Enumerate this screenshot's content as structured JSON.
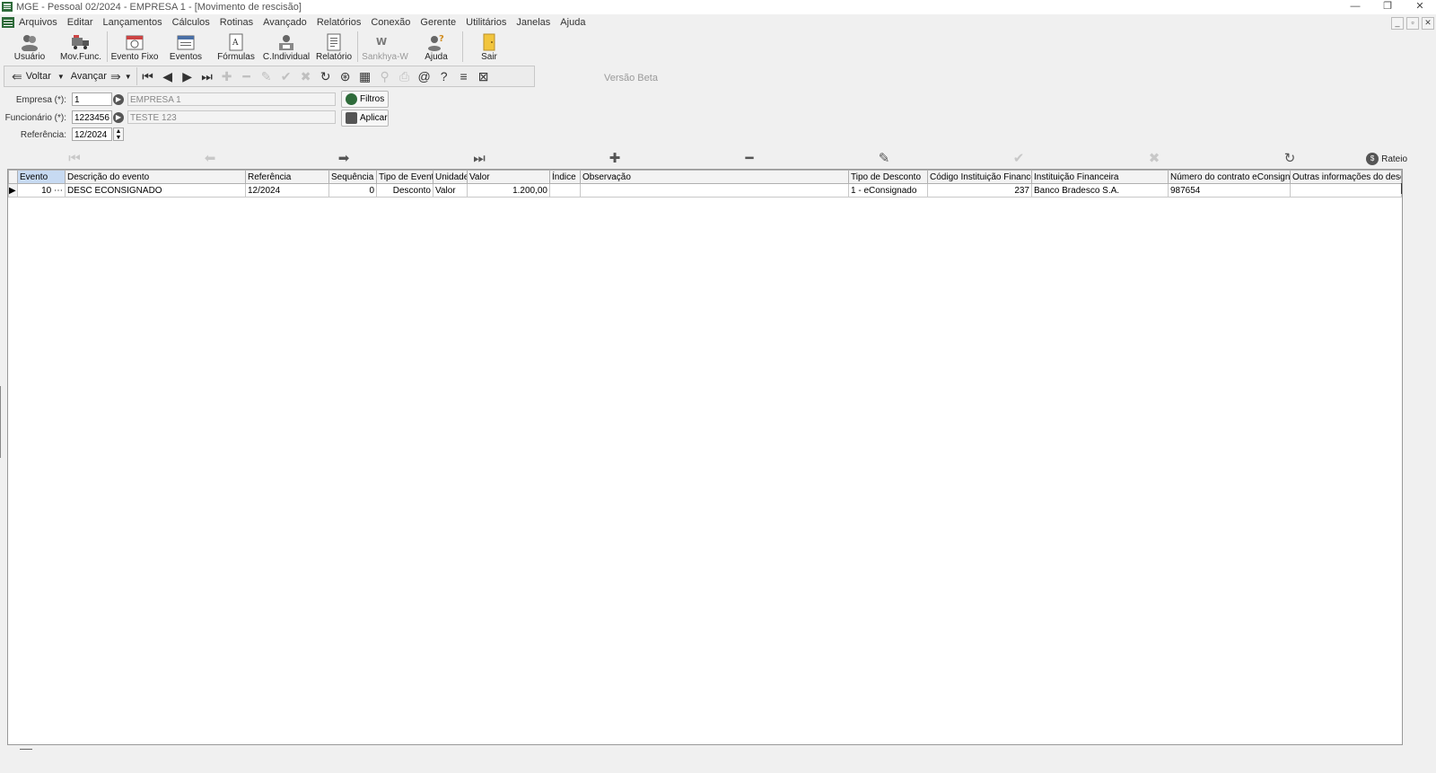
{
  "window": {
    "title": "MGE - Pessoal 02/2024 - EMPRESA 1 - [Movimento de rescisão]",
    "controls": [
      "—",
      "❐",
      "✕"
    ]
  },
  "menubar": {
    "items": [
      "Arquivos",
      "Editar",
      "Lançamentos",
      "Cálculos",
      "Rotinas",
      "Avançado",
      "Relatórios",
      "Conexão",
      "Gerente",
      "Utilitários",
      "Janelas",
      "Ajuda"
    ],
    "mdi_controls": [
      "_",
      "▫",
      "✕"
    ]
  },
  "toolbar_big": {
    "items": [
      {
        "label": "Usuário",
        "icon": "users-icon"
      },
      {
        "label": "Mov.Func.",
        "icon": "truck-icon"
      },
      {
        "label": "Evento Fixo",
        "icon": "calendar-icon"
      },
      {
        "label": "Eventos",
        "icon": "event-list-icon"
      },
      {
        "label": "Fórmulas",
        "icon": "formula-icon"
      },
      {
        "label": "C.Individual",
        "icon": "person-card-icon"
      },
      {
        "label": "Relatório",
        "icon": "report-icon"
      },
      {
        "label": "Sankhya-W",
        "icon": "sankhya-logo-icon"
      },
      {
        "label": "Ajuda",
        "icon": "help-person-icon"
      },
      {
        "label": "Sair",
        "icon": "exit-door-icon"
      }
    ]
  },
  "navbar": {
    "back_label": "Voltar",
    "forward_label": "Avançar"
  },
  "version_label": "Versão Beta",
  "form": {
    "empresa_label": "Empresa (*):",
    "empresa_code": "1",
    "empresa_name": "EMPRESA 1",
    "funcionario_label": "Funcionário (*):",
    "funcionario_code": "1223456",
    "funcionario_name": "TESTE 123",
    "referencia_label": "Referência:",
    "referencia_value": "12/2024",
    "filtros_label": "Filtros",
    "aplicar_label": "Aplicar"
  },
  "grid_nav": {
    "rateio_label": "Rateio"
  },
  "grid": {
    "columns": [
      "Evento",
      "Descrição do evento",
      "Referência",
      "Sequência",
      "Tipo de Evento",
      "Unidade",
      "Valor",
      "Índice",
      "Observação",
      "Tipo de Desconto",
      "Código Instituição Financeira",
      "Instituição Financeira",
      "Número do contrato eConsignado",
      "Outras informações do desc"
    ],
    "rows": [
      [
        "10",
        "DESC ECONSIGNADO",
        "12/2024",
        "0",
        "Desconto",
        "Valor",
        "1.200,00",
        "",
        "",
        "1 - eConsignado",
        "237",
        "Banco Bradesco S.A.",
        "987654",
        ""
      ]
    ]
  },
  "colors": {
    "window_bg": "#f0f0f0",
    "header_selected": "#c7daf2",
    "disabled_text": "#9a9a9a"
  }
}
